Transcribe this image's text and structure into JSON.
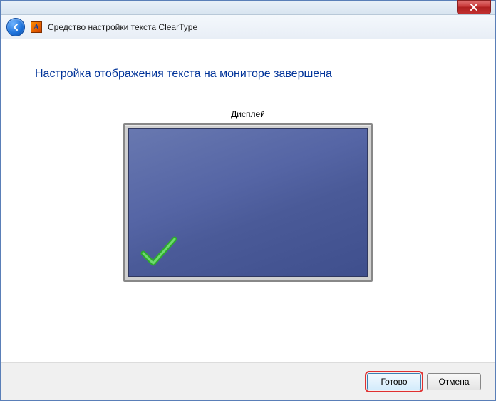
{
  "window": {
    "title": "Средство настройки текста ClearType"
  },
  "main": {
    "heading": "Настройка отображения текста на мониторе завершена",
    "display_label": "Дисплей"
  },
  "buttons": {
    "finish": "Готово",
    "cancel": "Отмена"
  },
  "app_icon_glyph": "A"
}
